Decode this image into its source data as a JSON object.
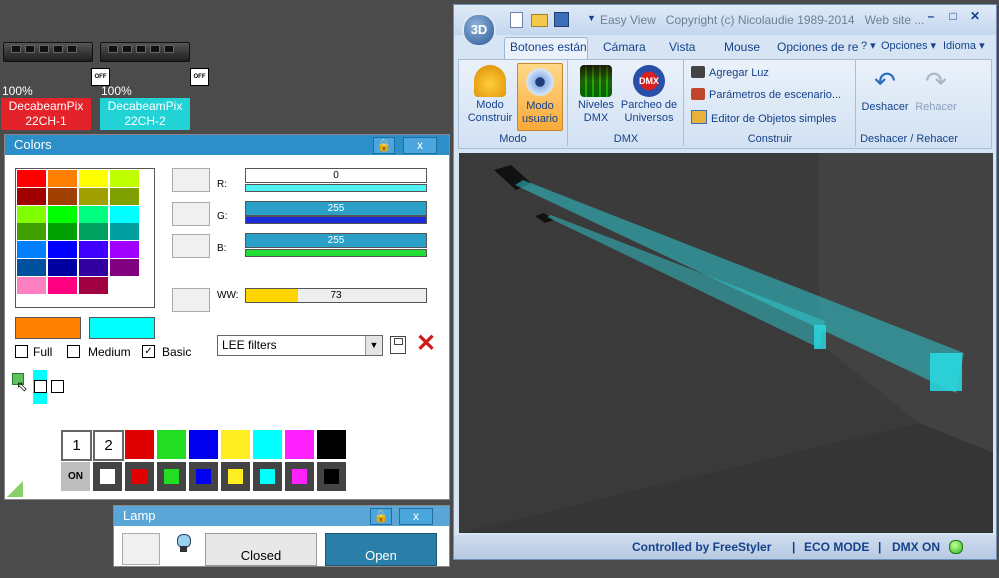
{
  "fixtures": [
    {
      "percent": "100%",
      "off_label": "OFF",
      "name_line1": "DecabeamPix",
      "name_line2": "22CH-1",
      "color": "#e32229"
    },
    {
      "percent": "100%",
      "off_label": "OFF",
      "name_line1": "DecabeamPix",
      "name_line2": "22CH-2",
      "color": "#22d3d6"
    }
  ],
  "colors_panel": {
    "title": "Colors",
    "close_label": "x",
    "palette": [
      [
        "#ff0000",
        "#ff8000",
        "#ffff00",
        "#c0ff00"
      ],
      [
        "#a00000",
        "#a04000",
        "#a0a000",
        "#80a000"
      ],
      [
        "#80ff00",
        "#00ff00",
        "#00ff80",
        "#00ffff"
      ],
      [
        "#40a000",
        "#00a000",
        "#00a060",
        "#00a0a0"
      ],
      [
        "#0080ff",
        "#0000ff",
        "#4000ff",
        "#a000ff"
      ],
      [
        "#0050a0",
        "#0000a0",
        "#3000a0",
        "#800080"
      ],
      [
        "#ff80c0",
        "#ff0080",
        "#a00040",
        "#ffffff"
      ]
    ],
    "r_label": "R:",
    "r_value": "0",
    "g_label": "G:",
    "g_value": "255",
    "b_label": "B:",
    "b_value": "255",
    "ww_label": "WW:",
    "ww_value": "73",
    "ww_fraction": 0.29,
    "swatch_left": "#ff8000",
    "swatch_right": "#00ffff",
    "checks": [
      {
        "label": "Full",
        "checked": false
      },
      {
        "label": "Medium",
        "checked": false
      },
      {
        "label": "Basic",
        "checked": true
      }
    ],
    "filter_select": "LEE filters",
    "number_buttons": [
      "1",
      "2"
    ],
    "on_label": "ON",
    "top_colors": [
      "#e00000",
      "#22dd22",
      "#0000ee",
      "#ffee22",
      "#00ffff",
      "#ff22ff",
      "#000000"
    ],
    "bottom_colors": [
      "#ffffff",
      "#e00000",
      "#22dd22",
      "#0000ee",
      "#ffee22",
      "#00ffff",
      "#ff22ff",
      "#000000"
    ]
  },
  "lamp_panel": {
    "title": "Lamp",
    "close_label": "x",
    "closed_label": "Closed",
    "open_label": "Open"
  },
  "main_window": {
    "title": "Easy View   Copyright (c) Nicolaudie 1989-2014   Web site ...",
    "tabs": [
      "Botones están",
      "Cámara",
      "Vista",
      "Mouse",
      "Opciones de re"
    ],
    "right_menu": [
      "? ▾",
      "Opciones ▾",
      "Idioma ▾"
    ],
    "groups": {
      "modo": {
        "name": "Modo",
        "btn1": [
          "Modo",
          "Construir"
        ],
        "btn2": [
          "Modo",
          "usuario"
        ]
      },
      "dmx": {
        "name": "DMX",
        "btn1": [
          "Niveles",
          "DMX"
        ],
        "btn2": [
          "Parcheo de",
          "Universos"
        ]
      },
      "construir": {
        "name": "Construir",
        "items": [
          "Agregar Luz",
          "Parámetros de escenario...",
          "Editor de Objetos simples"
        ]
      },
      "undo": {
        "name": "Deshacer / Rehacer",
        "undo": "Deshacer",
        "redo": "Rehacer"
      }
    },
    "status": [
      "Controlled by FreeStyler",
      "|",
      "ECO MODE",
      "|",
      "DMX ON"
    ],
    "beam_color": "#2ec9d1"
  }
}
